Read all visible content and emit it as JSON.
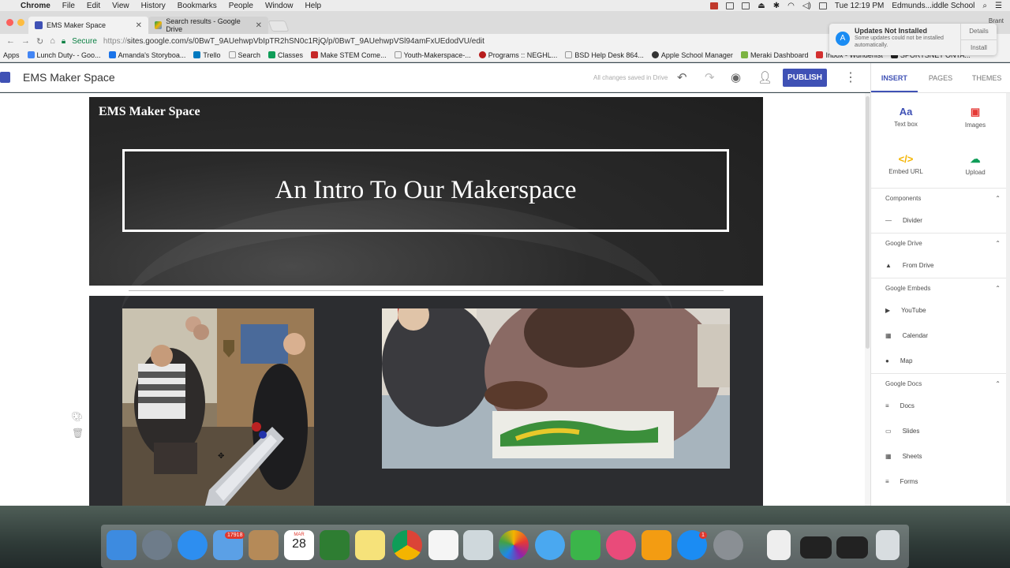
{
  "menubar": {
    "app": "Chrome",
    "items": [
      "File",
      "Edit",
      "View",
      "History",
      "Bookmarks",
      "People",
      "Window",
      "Help"
    ],
    "clock": "Tue 12:19 PM",
    "user": "Edmunds...iddle School"
  },
  "tabs": [
    {
      "title": "EMS Maker Space",
      "active": true
    },
    {
      "title": "Search results - Google Drive",
      "active": false
    }
  ],
  "chrome_person": "Brant",
  "address": {
    "secure": "Secure",
    "url_prefix": "https://",
    "url": "sites.google.com/s/0BwT_9AUehwpVbIpTR2hSN0c1RjQ/p/0BwT_9AUehwpVSl94amFxUEdodVU/edit"
  },
  "bookmarks": [
    "Apps",
    "Lunch Duty- - Goo...",
    "Amanda's Storyboa...",
    "Trello",
    "Search",
    "Classes",
    "Make STEM Come...",
    "Youth-Makerspace-...",
    "Programs :: NEGHL...",
    "BSD Help Desk 864...",
    "Apple School Manager",
    "Meraki Dashboard",
    "Inbox - Wunderlist",
    "SPORTSNET ONTA..."
  ],
  "notification": {
    "title": "Updates Not Installed",
    "message": "Some updates could not be installed automatically.",
    "details": "Details",
    "install": "Install"
  },
  "appbar": {
    "title": "EMS Maker Space",
    "saved": "All changes saved in Drive",
    "publish": "PUBLISH"
  },
  "page": {
    "site_name": "EMS Maker Space",
    "hero_title": "An Intro To Our Makerspace"
  },
  "panel": {
    "tabs": [
      "INSERT",
      "PAGES",
      "THEMES"
    ],
    "tiles": [
      {
        "label": "Text box",
        "glyph": "Aa",
        "color": "#3f51b5"
      },
      {
        "label": "Images",
        "glyph": "▣",
        "color": "#e53935"
      },
      {
        "label": "Embed URL",
        "glyph": "</>",
        "color": "#f4b400"
      },
      {
        "label": "Upload",
        "glyph": "☁",
        "color": "#0f9d58"
      }
    ],
    "sections": [
      {
        "title": "Components",
        "items": [
          {
            "label": "Divider",
            "glyph": "—"
          }
        ]
      },
      {
        "title": "Google Drive",
        "items": [
          {
            "label": "From Drive",
            "glyph": "▲"
          }
        ]
      },
      {
        "title": "Google Embeds",
        "items": [
          {
            "label": "YouTube",
            "glyph": "▶"
          },
          {
            "label": "Calendar",
            "glyph": "▦"
          },
          {
            "label": "Map",
            "glyph": "●"
          }
        ]
      },
      {
        "title": "Google Docs",
        "items": [
          {
            "label": "Docs",
            "glyph": "≡"
          },
          {
            "label": "Slides",
            "glyph": "▭"
          },
          {
            "label": "Sheets",
            "glyph": "▦"
          },
          {
            "label": "Forms",
            "glyph": "≡"
          }
        ]
      }
    ]
  },
  "dock": {
    "mail_badge": "17918",
    "calendar_month": "MAR",
    "calendar_day": "28",
    "appstore_badge": "1"
  }
}
